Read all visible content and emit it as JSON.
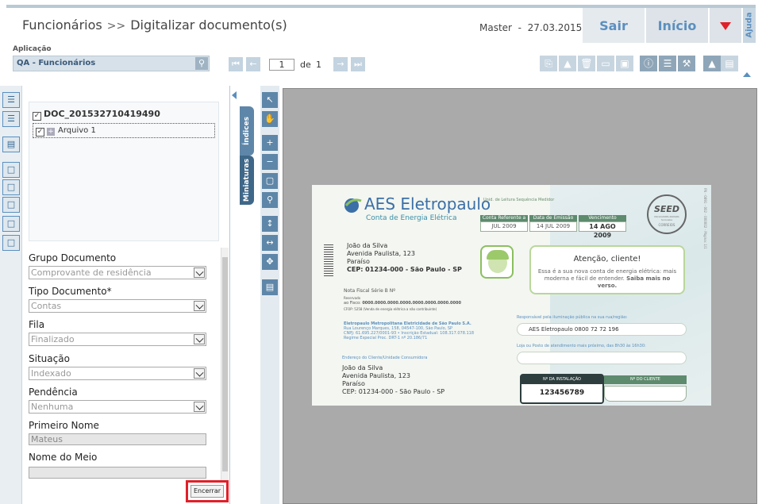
{
  "header": {
    "breadcrumb_root": "Funcionários",
    "breadcrumb_sep": ">>",
    "breadcrumb_page": "Digitalizar documento(s)",
    "user": "Master",
    "date_sep": "-",
    "date": "27.03.2015",
    "sair": "Sair",
    "inicio": "Início",
    "ajuda": "Ajuda"
  },
  "app": {
    "label": "Aplicação",
    "value": "QA - Funcionários"
  },
  "pager": {
    "current": "1",
    "of": "de",
    "total": "1"
  },
  "tree": {
    "document": "DOC_201532710419490",
    "file": "Arquivo 1"
  },
  "tabs": {
    "indices": "Índices",
    "miniaturas": "Miniaturas"
  },
  "form": {
    "grupo_label": "Grupo Documento",
    "grupo_value": "Comprovante de residência",
    "tipo_label": "Tipo Documento*",
    "tipo_value": "Contas",
    "fila_label": "Fila",
    "fila_value": "Finalizado",
    "situacao_label": "Situação",
    "situacao_value": "Indexado",
    "pendencia_label": "Pendência",
    "pendencia_value": "Nenhuma",
    "primeiro_label": "Primeiro Nome",
    "primeiro_value": "Mateus",
    "meio_label": "Nome do Meio",
    "meio_value": "",
    "encerrar": "Encerrar"
  },
  "bill": {
    "brand": "AES Eletropaulo",
    "subtitle": "Conta de Energia Elétrica",
    "top_links": "Unid. de Leitura     Sequência     Medidor",
    "hdr_ref": "Conta Referente a",
    "hdr_emissao": "Data de Emissão",
    "hdr_venc": "Vencimento",
    "val_ref": "JUL 2009",
    "val_emissao": "14 JUL 2009",
    "val_venc": "14 AGO 2009",
    "seed": "SEED",
    "seed_small": "09/12/2008•2009/PA Sorocaba",
    "seed_corr": "CORREIOS",
    "side_text": "FN - 0891 - 002 - 000002 - Página: 1/1",
    "name": "João da Silva",
    "street": "Avenida Paulista, 123",
    "district": "Paraíso",
    "cep": "CEP: 01234-000 - São Paulo - SP",
    "nf_title": "Nota Fiscal Série B Nº",
    "nf_res_a": "Reservado",
    "nf_res_b": "ao Fisco:",
    "nf_num": "0000.0000.0000.0000.0000.0000.0000.0000",
    "nf_cfop": "CFOP: 5258 (Venda de energia elétrica a não contribuinte)",
    "comp_name": "Eletropaulo Metropolitana Eletricidade de São Paulo S.A.",
    "comp_addr": "Rua Lourenço Marques, 158, 04547-100, São Paulo, SP",
    "comp_cnpj": "CNPJ: 61.695.227/0001-93 • Inscrição Estadual: 108.317.078.118",
    "comp_reg": "Regime Especial Proc. DRT-1 nº 20.186/71",
    "end_lbl": "Endereço do Cliente/Unidade Consumidora",
    "attention": "Atenção, cliente!",
    "msg_a": "Essa é a sua nova conta de energia elétrica: mais moderna e fácil de entender.",
    "msg_b": "Saiba mais no verso.",
    "resp_lbl": "Responsável pela iluminação pública na sua rua/região:",
    "resp_val": "AES Eletropaulo 0800 72 72 196",
    "loja_lbl": "Loja ou Posto de atendimento mais próximo, das 8h30 às 16h30:",
    "inst_hdr": "Nº DA INSTALAÇÃO",
    "inst_val": "123456789",
    "cli_hdr": "Nº DO CLIENTE"
  }
}
